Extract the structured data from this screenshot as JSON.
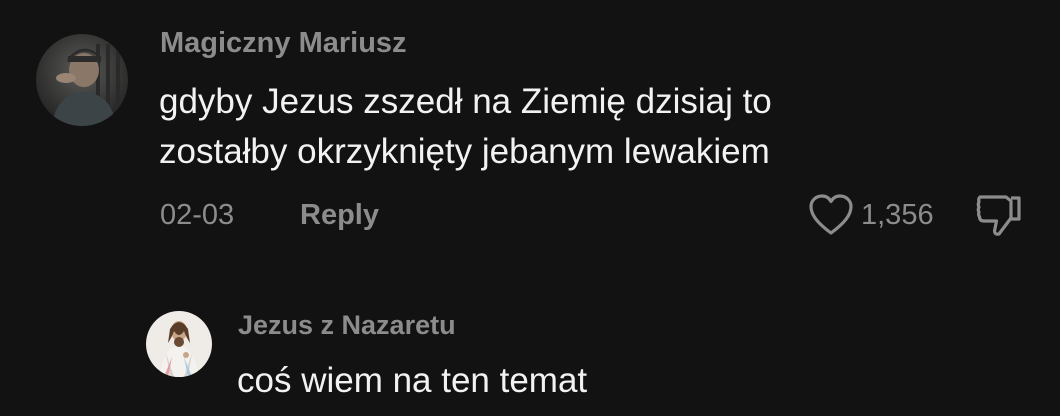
{
  "comment": {
    "username": "Magiczny Mariusz",
    "text_line1": "gdyby Jezus zszedł na Ziemię dzisiaj to",
    "text_line2": "zostałby okrzyknięty jebanym lewakiem",
    "date": "02-03",
    "reply_label": "Reply",
    "like_count": "1,356",
    "like_icon": "heart-outline-icon",
    "dislike_icon": "thumbs-down-icon"
  },
  "reply": {
    "username": "Jezus z Nazaretu",
    "text": "coś wiem na ten temat"
  },
  "colors": {
    "background": "#121212",
    "username": "#8c8c8c",
    "text": "#f2f2f2",
    "meta": "#8c8c8c"
  }
}
